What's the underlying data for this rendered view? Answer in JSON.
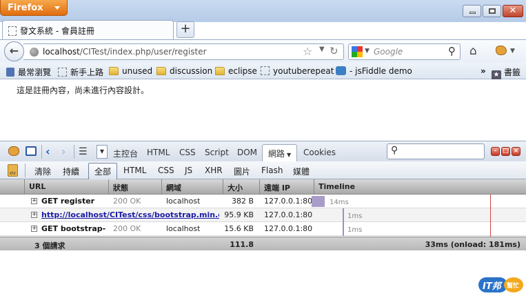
{
  "app": {
    "menu_label": "Firefox"
  },
  "tab": {
    "title": "發文系統 - 會員註冊"
  },
  "nav": {
    "url_domain": "localhost",
    "url_path": "/CITest/index.php/user/register",
    "search_placeholder": "Google"
  },
  "bookmarks": [
    {
      "label": "最常瀏覽",
      "icon": "book-icon"
    },
    {
      "label": "新手上路",
      "icon": "page-icon"
    },
    {
      "label": "unused",
      "icon": "folder-icon"
    },
    {
      "label": "discussion",
      "icon": "folder-icon"
    },
    {
      "label": "eclipse",
      "icon": "folder-icon"
    },
    {
      "label": "youtuberepeat",
      "icon": "page-icon"
    },
    {
      "label": "- jsFiddle demo",
      "icon": "cloud-icon"
    }
  ],
  "bookmarks_more": "»",
  "bookmarks_menu": "書籤",
  "content": {
    "text": "這是註冊內容，尚未進行內容設計。"
  },
  "firebug": {
    "panels": [
      "主控台",
      "HTML",
      "CSS",
      "Script",
      "DOM",
      "網路",
      "Cookies"
    ],
    "active_panel": "網路"
  },
  "net": {
    "filters": [
      "清除",
      "持續",
      "全部",
      "HTML",
      "CSS",
      "JS",
      "XHR",
      "圖片",
      "Flash",
      "媒體"
    ],
    "active_filter": "全部",
    "columns": [
      "URL",
      "狀態",
      "網域",
      "大小",
      "遠端 IP",
      "Timeline"
    ],
    "rows": [
      {
        "url": "GET register",
        "status": "200 OK",
        "domain": "localhost",
        "size": "382 B",
        "ip": "127.0.0.1:80",
        "time": "14ms"
      },
      {
        "url": "http://localhost/CITest/css/bootstrap.min.css",
        "status": "",
        "domain": "",
        "size": "95.9 KB",
        "ip": "127.0.0.1:80",
        "time": "1ms"
      },
      {
        "url": "GET bootstrap-",
        "status": "200 OK",
        "domain": "localhost",
        "size": "15.6 KB",
        "ip": "127.0.0.1:80",
        "time": "1ms"
      }
    ],
    "summary": {
      "requests": "3 個請求",
      "total": "111.8 KB",
      "timing": "33ms (onload: 181ms)"
    }
  },
  "watermark": "IT邦幫忙",
  "colors": {
    "firefox_button": "#e47b1c",
    "link": "#1a1aa6",
    "timeline_bar": "#a99cc8",
    "onload_line": "#cc4444"
  }
}
